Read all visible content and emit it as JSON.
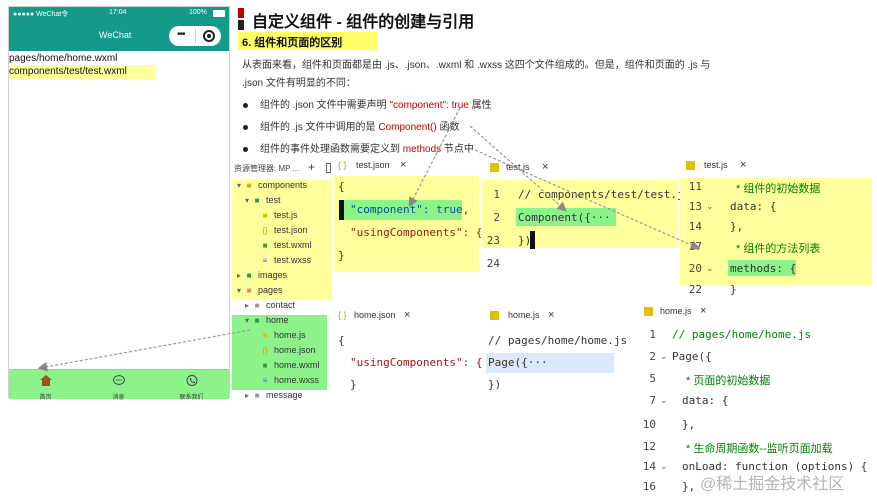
{
  "colors": {
    "teal": "#139a89",
    "highlight_yellow": "#ffff9c",
    "highlight_green": "#8cf28a",
    "accent_red": "#c00000",
    "code_string": "#a31515",
    "code_comment": "#008000"
  },
  "phone": {
    "status": {
      "carrier": "●●●●● WeChat令",
      "time": "17:04",
      "battery": "100%"
    },
    "nav_title": "WeChat",
    "capsule": {
      "more_icon": "more-dots-icon",
      "close_icon": "target-icon"
    },
    "lines": [
      "pages/home/home.wxml",
      "components/test/test.wxml"
    ],
    "tabs": [
      {
        "label": "首页",
        "icon": "home-icon"
      },
      {
        "label": "消息",
        "icon": "message-icon"
      },
      {
        "label": "联系我们",
        "icon": "phone-icon"
      }
    ]
  },
  "slide": {
    "title": "自定义组件 - 组件的创建与引用",
    "section": "6. 组件和页面的区别",
    "para_line1": "从表面来看，组件和页面都是由 .js、.json、.wxml 和 .wxss 这四个文件组成的。但是，组件和页面的 .js 与",
    "para_line2": ".json 文件有明显的不同：",
    "bullets": [
      {
        "pre": "组件的 .json 文件中需要声明 ",
        "code": "\"component\": true",
        "post": " 属性"
      },
      {
        "pre": "组件的 .js 文件中调用的是 ",
        "code": "Component()",
        "post": " 函数"
      },
      {
        "pre": "组件的事件处理函数需要定义到 ",
        "code": "methods",
        "post": " 节点中"
      }
    ]
  },
  "explorer": {
    "header": "资源管理器: MP ...",
    "plus": "+",
    "items": [
      {
        "label": "components",
        "indent": 0,
        "arrow": "▾",
        "icon": "■",
        "icon_color": "#e2a800"
      },
      {
        "label": "test",
        "indent": 1,
        "arrow": "▾",
        "icon": "■",
        "icon_color": "#1aa04a"
      },
      {
        "label": "test.js",
        "indent": 2,
        "arrow": "",
        "icon": "■",
        "icon_color": "#e2c000"
      },
      {
        "label": "test.json",
        "indent": 2,
        "arrow": "",
        "icon": "{}",
        "icon_color": "#c9a000"
      },
      {
        "label": "test.wxml",
        "indent": 2,
        "arrow": "",
        "icon": "■",
        "icon_color": "#3a9a3a"
      },
      {
        "label": "test.wxss",
        "indent": 2,
        "arrow": "",
        "icon": "≡",
        "icon_color": "#2a7ac0"
      },
      {
        "label": "images",
        "indent": 0,
        "arrow": "▸",
        "icon": "■",
        "icon_color": "#1aa04a"
      },
      {
        "label": "pages",
        "indent": 0,
        "arrow": "▾",
        "icon": "■",
        "icon_color": "#e08a5a"
      },
      {
        "label": "contact",
        "indent": 1,
        "arrow": "▸",
        "icon": "■",
        "icon_color": "#999999"
      },
      {
        "label": "home",
        "indent": 1,
        "arrow": "▾",
        "icon": "■",
        "icon_color": "#1aa04a"
      },
      {
        "label": "home.js",
        "indent": 2,
        "arrow": "",
        "icon": "■",
        "icon_color": "#e2c000"
      },
      {
        "label": "home.json",
        "indent": 2,
        "arrow": "",
        "icon": "{}",
        "icon_color": "#c9a000"
      },
      {
        "label": "home.wxml",
        "indent": 2,
        "arrow": "",
        "icon": "■",
        "icon_color": "#3a9a3a"
      },
      {
        "label": "home.wxss",
        "indent": 2,
        "arrow": "",
        "icon": "≡",
        "icon_color": "#2a7ac0"
      },
      {
        "label": "message",
        "indent": 1,
        "arrow": "▸",
        "icon": "■",
        "icon_color": "#999999"
      }
    ]
  },
  "editors": {
    "test_json": {
      "tab": "test.json",
      "close": "×",
      "lines": [
        "{",
        "\"component\": true,",
        "\"usingComponents\": {}",
        "}"
      ]
    },
    "test_js": {
      "tab": "test.js",
      "close": "×",
      "line_numbers": [
        "1",
        "2",
        "23",
        "24"
      ],
      "lines": [
        "// components/test/test.js",
        "Component({···",
        "})",
        ""
      ]
    },
    "test_js2": {
      "tab": "test.js",
      "close": "×",
      "line_numbers": [
        "11",
        "13",
        "14",
        "17",
        "20",
        "22"
      ],
      "lines": [
        "* 组件的初始数据",
        "data: {",
        "},",
        "* 组件的方法列表",
        "methods: {",
        "}"
      ]
    },
    "home_json": {
      "tab": "home.json",
      "close": "×",
      "lines": [
        "{",
        "\"usingComponents\": {",
        "}"
      ]
    },
    "home_js_small": {
      "tab": "home.js",
      "close": "×",
      "lines": [
        "// pages/home/home.js",
        "Page({···",
        "})"
      ]
    },
    "home_js": {
      "tab": "home.js",
      "close": "×",
      "line_numbers": [
        "1",
        "2",
        "5",
        "7",
        "10",
        "12",
        "14",
        "16"
      ],
      "lines": [
        "// pages/home/home.js",
        "Page({",
        "* 页面的初始数据",
        "data: {",
        "},",
        "* 生命周期函数--监听页面加载",
        "onLoad: function (options) {",
        "},"
      ]
    }
  },
  "watermark": "@稀土掘金技术社区"
}
